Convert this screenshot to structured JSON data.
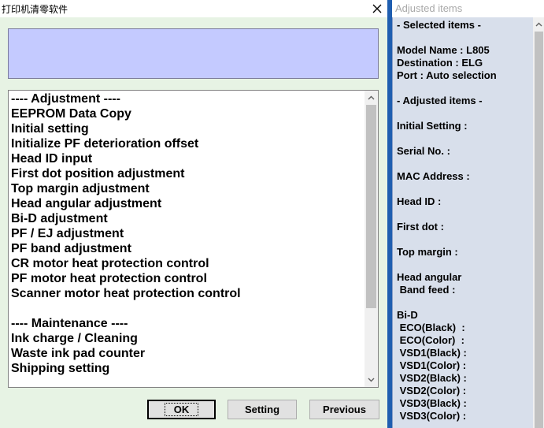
{
  "window": {
    "title": "打印机清零软件",
    "close_icon": "close-icon"
  },
  "display": {
    "text": ""
  },
  "menu": {
    "items": [
      "---- Adjustment ----",
      "EEPROM Data Copy",
      "Initial setting",
      "Initialize PF deterioration offset",
      "Head ID input",
      "First dot position adjustment",
      "Top margin adjustment",
      "Head angular adjustment",
      "Bi-D adjustment",
      "PF / EJ adjustment",
      "PF band adjustment",
      "CR motor heat protection control",
      "PF motor heat protection control",
      "Scanner motor heat protection control",
      "",
      "---- Maintenance ----",
      "Ink charge / Cleaning",
      "Waste ink pad counter",
      "Shipping setting"
    ]
  },
  "buttons": {
    "ok": "OK",
    "setting": "Setting",
    "previous": "Previous"
  },
  "panel": {
    "title": "Adjusted items",
    "lines": [
      "- Selected items -",
      "",
      "Model Name : L805",
      "Destination : ELG",
      "Port : Auto selection",
      "",
      "- Adjusted items -",
      "",
      "Initial Setting :",
      "",
      "Serial No. :",
      "",
      "MAC Address :",
      "",
      "Head ID :",
      "",
      "First dot :",
      "",
      "Top margin :",
      "",
      "Head angular",
      " Band feed :",
      "",
      "Bi-D",
      " ECO(Black)  :",
      " ECO(Color)  :",
      " VSD1(Black) :",
      " VSD1(Color) :",
      " VSD2(Black) :",
      " VSD2(Color) :",
      " VSD3(Black) :",
      " VSD3(Color) :"
    ]
  },
  "colors": {
    "dialog_bg": "#e7f3e4",
    "display_bg": "#c4caff",
    "divider": "#1f5eb0",
    "panel_bg": "#d8dfeb"
  }
}
